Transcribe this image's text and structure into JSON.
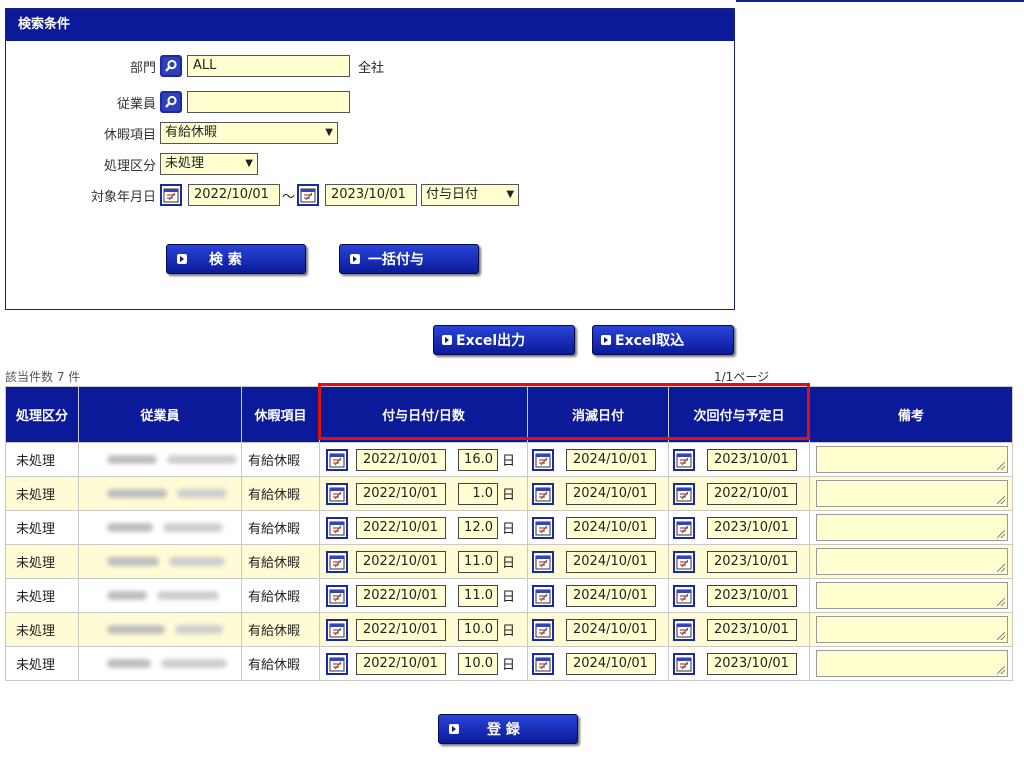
{
  "panel": {
    "title": "検索条件",
    "dept": {
      "label": "部門",
      "value": "ALL",
      "after": "全社"
    },
    "employee": {
      "label": "従業員",
      "value": ""
    },
    "leave_item": {
      "label": "休暇項目",
      "value": "有給休暇"
    },
    "process": {
      "label": "処理区分",
      "value": "未処理"
    },
    "date": {
      "label": "対象年月日",
      "from": "2022/10/01",
      "sep": "〜",
      "to": "2023/10/01",
      "kind": "付与日付"
    },
    "search_label": "検 索",
    "bulk_label": "一括付与"
  },
  "excel": {
    "export_label": "Excel出力",
    "import_label": "Excel取込"
  },
  "result": {
    "count": "該当件数 7 件",
    "page": "1/1ページ"
  },
  "table": {
    "headers": [
      "処理区分",
      "従業員",
      "休暇項目",
      "付与日付/日数",
      "消滅日付",
      "次回付与予定日",
      "備考"
    ],
    "day_unit": "日",
    "rows": [
      {
        "status": "未処理",
        "item": "有給休暇",
        "grant": "2022/10/01",
        "days": "16.0",
        "expire": "2024/10/01",
        "next": "2023/10/01"
      },
      {
        "status": "未処理",
        "item": "有給休暇",
        "grant": "2022/10/01",
        "days": "1.0",
        "expire": "2024/10/01",
        "next": "2022/10/01"
      },
      {
        "status": "未処理",
        "item": "有給休暇",
        "grant": "2022/10/01",
        "days": "12.0",
        "expire": "2024/10/01",
        "next": "2023/10/01"
      },
      {
        "status": "未処理",
        "item": "有給休暇",
        "grant": "2022/10/01",
        "days": "11.0",
        "expire": "2024/10/01",
        "next": "2023/10/01"
      },
      {
        "status": "未処理",
        "item": "有給休暇",
        "grant": "2022/10/01",
        "days": "11.0",
        "expire": "2024/10/01",
        "next": "2023/10/01"
      },
      {
        "status": "未処理",
        "item": "有給休暇",
        "grant": "2022/10/01",
        "days": "10.0",
        "expire": "2024/10/01",
        "next": "2023/10/01"
      },
      {
        "status": "未処理",
        "item": "有給休暇",
        "grant": "2022/10/01",
        "days": "10.0",
        "expire": "2024/10/01",
        "next": "2023/10/01"
      }
    ]
  },
  "register_label": "登 録",
  "colors": {
    "header_blue": "#0a1a98",
    "input_yellow": "#ffffd0",
    "row_alt": "#fffbd4",
    "highlight_red": "#e01010"
  },
  "icons": {
    "lookup": "magnifier-icon",
    "calendar": "calendar-icon",
    "button": "arrow-right-icon"
  }
}
